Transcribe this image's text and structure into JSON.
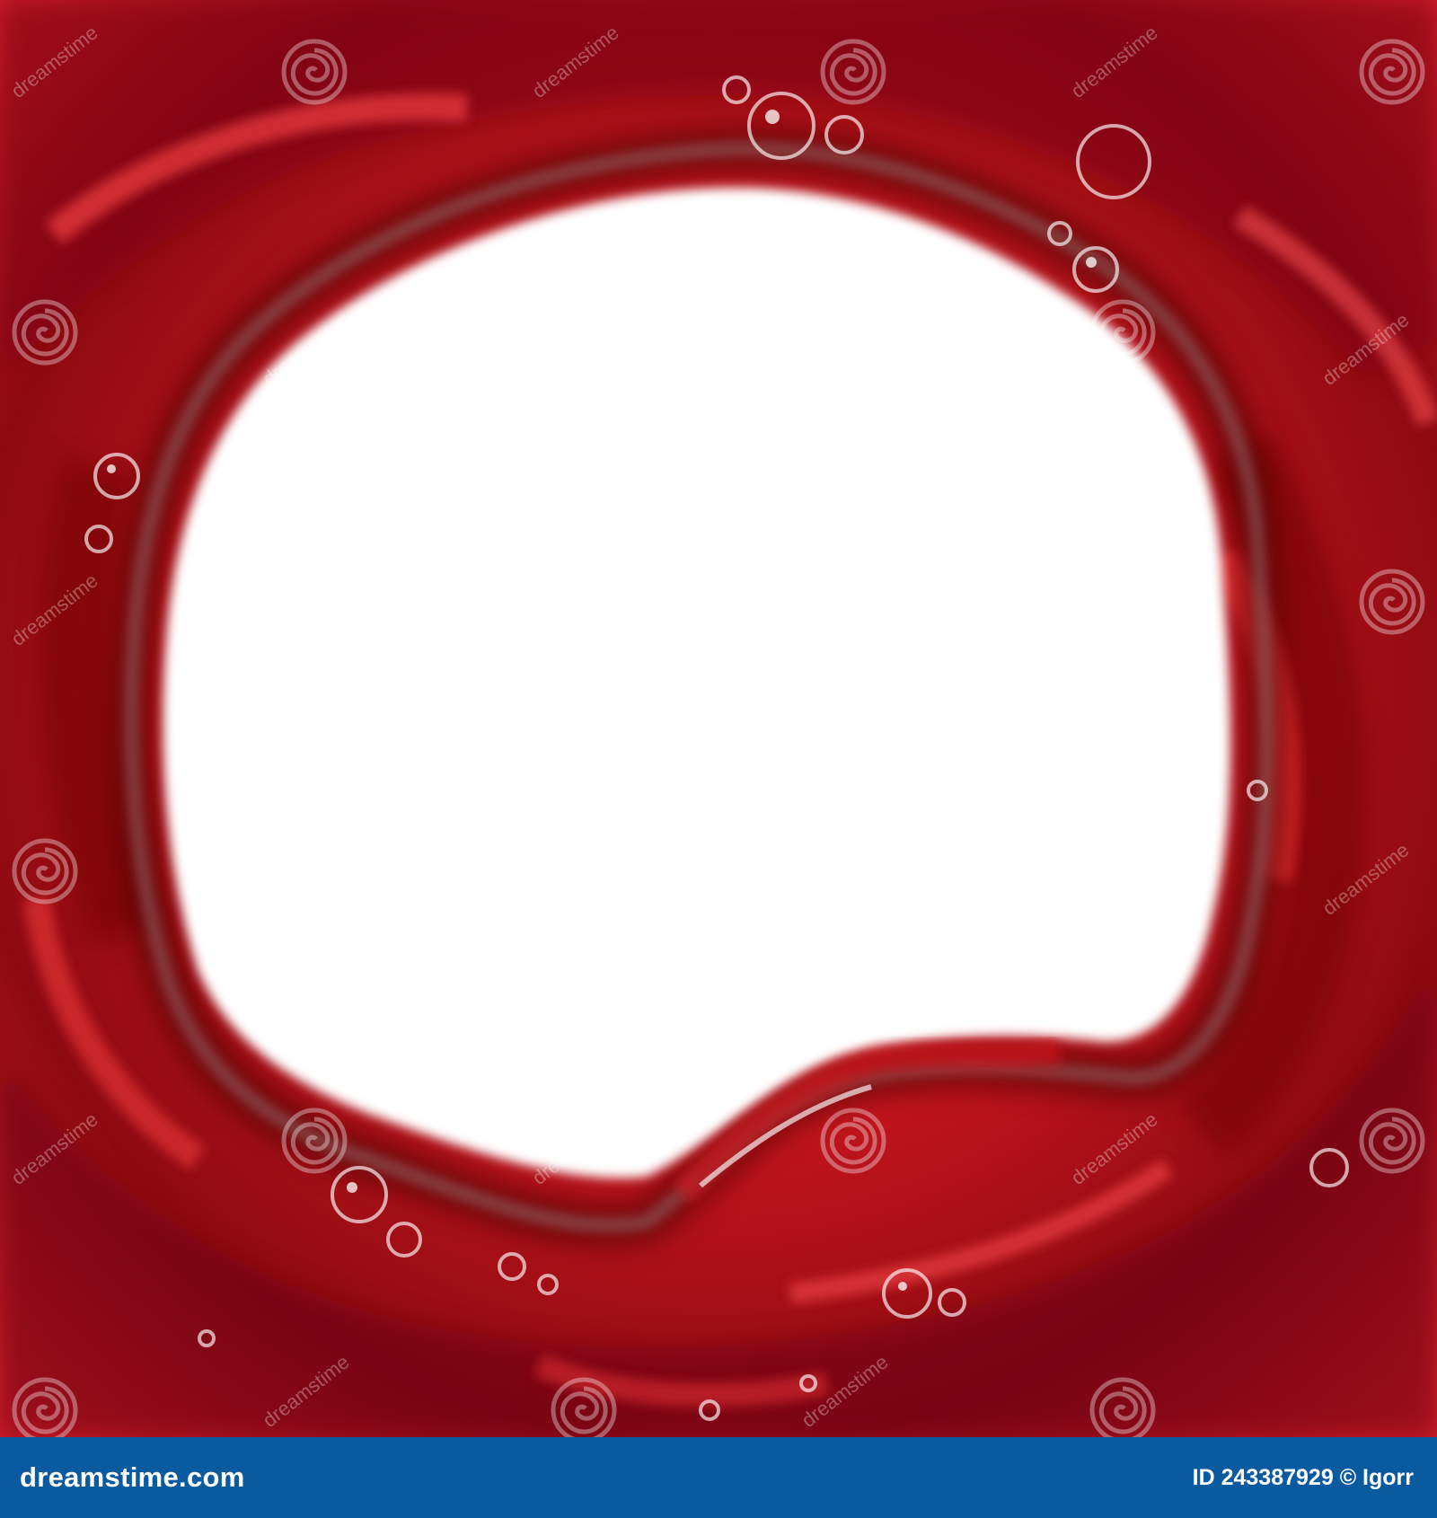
{
  "photo": {
    "subject": "red wine swirling splash forming a frame around a white center",
    "colors": {
      "wine_dark": "#5c0008",
      "wine_mid": "#b0101a",
      "wine_bright": "#e22a2e",
      "highlight": "#ffffff"
    },
    "watermark": {
      "text": "dreamstime",
      "icon": "spiral-logo-icon"
    }
  },
  "footer": {
    "brand": "dreamstime.com",
    "image_id_label": "ID 243387929",
    "author_label": "© Igorr",
    "background_color": "#0a5aa0"
  }
}
